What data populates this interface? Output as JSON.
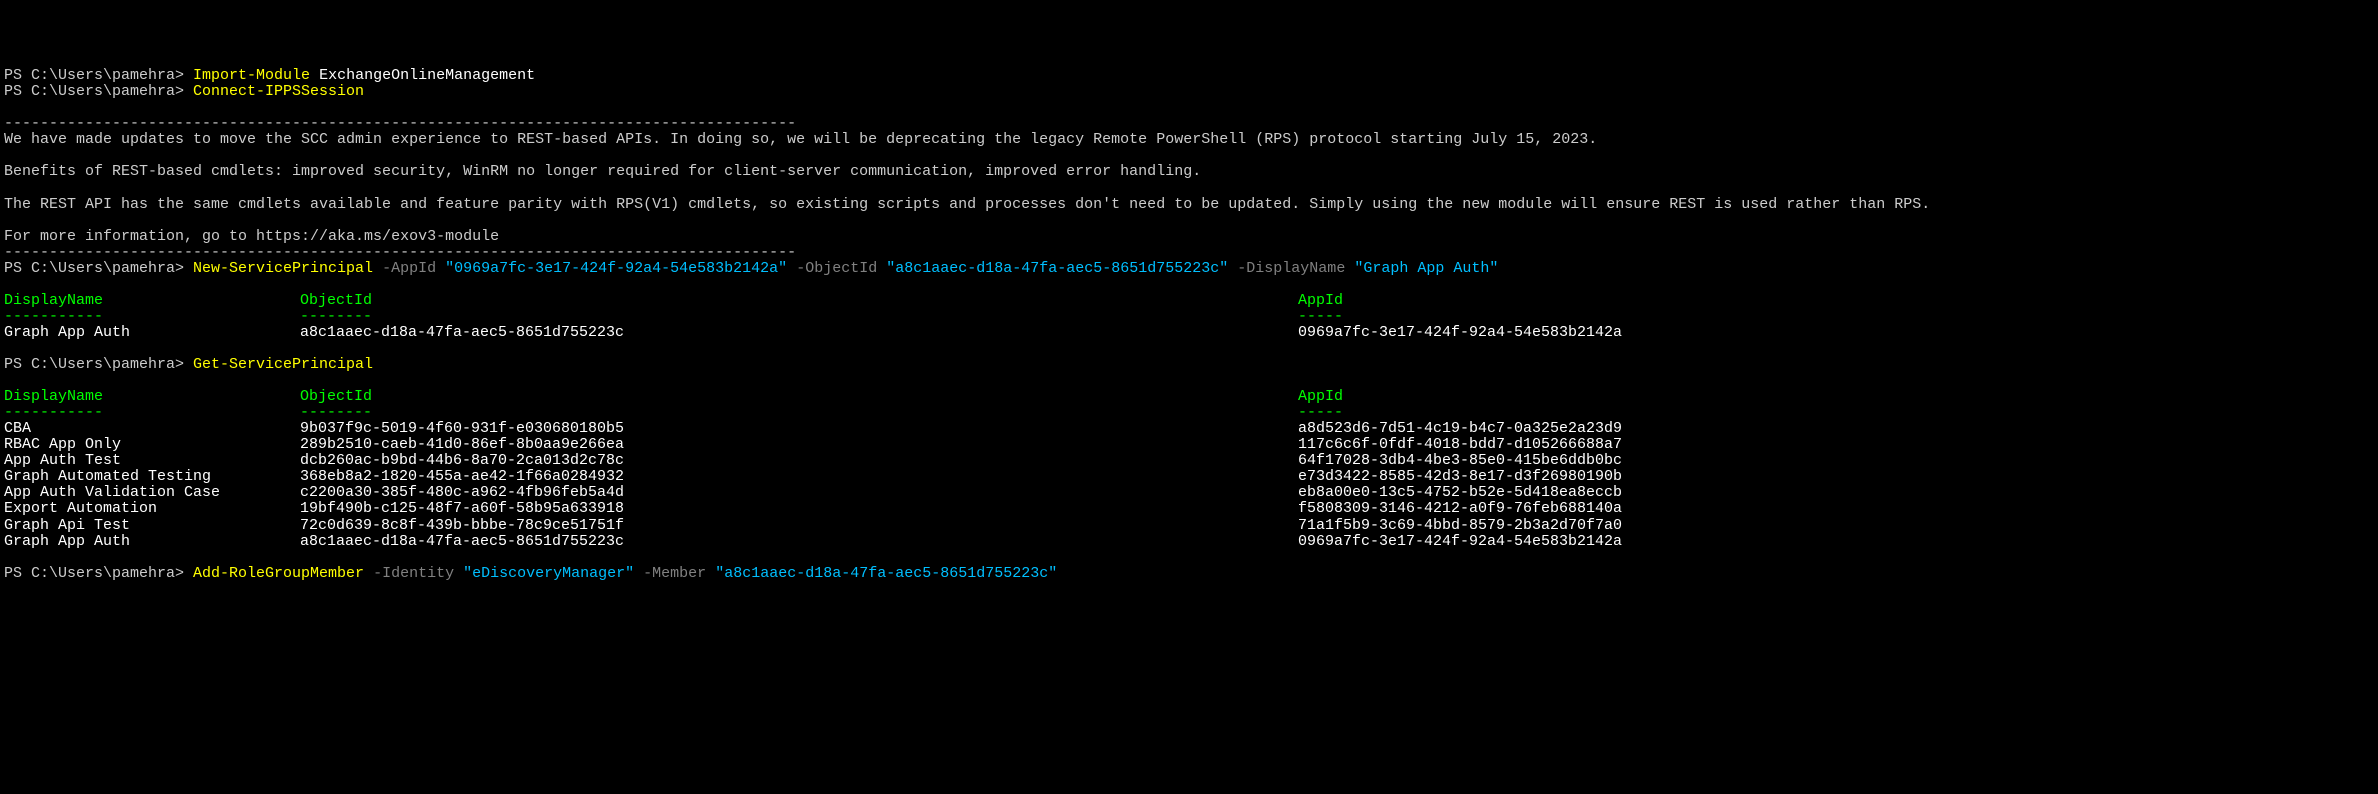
{
  "prompt_text": "PS C:\\Users\\pamehra> ",
  "line1": {
    "cmd": "Import-Module",
    "arg": "ExchangeOnlineManagement"
  },
  "line2": {
    "cmd": "Connect-IPPSSession"
  },
  "separator1": "----------------------------------------------------------------------------------------",
  "banner": {
    "l1": "We have made updates to move the SCC admin experience to REST-based APIs. In doing so, we will be deprecating the legacy Remote PowerShell (RPS) protocol starting July 15, 2023.",
    "l2": "Benefits of REST-based cmdlets: improved security, WinRM no longer required for client-server communication, improved error handling.",
    "l3": "The REST API has the same cmdlets available and feature parity with RPS(V1) cmdlets, so existing scripts and processes don't need to be updated. Simply using the new module will ensure REST is used rather than RPS.",
    "l4": "For more information, go to https://aka.ms/exov3-module"
  },
  "separator2": "----------------------------------------------------------------------------------------",
  "line3": {
    "cmd": "New-ServicePrincipal",
    "p1": "-AppId",
    "v1": "\"0969a7fc-3e17-424f-92a4-54e583b2142a\"",
    "p2": "-ObjectId",
    "v2": "\"a8c1aaec-d18a-47fa-aec5-8651d755223c\"",
    "p3": "-DisplayName",
    "v3": "\"Graph App Auth\""
  },
  "table1": {
    "headers": {
      "displayname": "DisplayName",
      "objectid": "ObjectId",
      "appid": "AppId"
    },
    "dashes": {
      "displayname": "-----------",
      "objectid": "--------",
      "appid": "-----"
    },
    "rows": [
      {
        "dn": "Graph App Auth",
        "oid": "a8c1aaec-d18a-47fa-aec5-8651d755223c",
        "aid": "0969a7fc-3e17-424f-92a4-54e583b2142a"
      }
    ]
  },
  "line4": {
    "cmd": "Get-ServicePrincipal"
  },
  "table2": {
    "headers": {
      "displayname": "DisplayName",
      "objectid": "ObjectId",
      "appid": "AppId"
    },
    "dashes": {
      "displayname": "-----------",
      "objectid": "--------",
      "appid": "-----"
    },
    "rows": [
      {
        "dn": "CBA",
        "oid": "9b037f9c-5019-4f60-931f-e030680180b5",
        "aid": "a8d523d6-7d51-4c19-b4c7-0a325e2a23d9"
      },
      {
        "dn": "RBAC App Only",
        "oid": "289b2510-caeb-41d0-86ef-8b0aa9e266ea",
        "aid": "117c6c6f-0fdf-4018-bdd7-d105266688a7"
      },
      {
        "dn": "App Auth Test",
        "oid": "dcb260ac-b9bd-44b6-8a70-2ca013d2c78c",
        "aid": "64f17028-3db4-4be3-85e0-415be6ddb0bc"
      },
      {
        "dn": "Graph Automated Testing",
        "oid": "368eb8a2-1820-455a-ae42-1f66a0284932",
        "aid": "e73d3422-8585-42d3-8e17-d3f26980190b"
      },
      {
        "dn": "App Auth Validation Case",
        "oid": "c2200a30-385f-480c-a962-4fb96feb5a4d",
        "aid": "eb8a00e0-13c5-4752-b52e-5d418ea8eccb"
      },
      {
        "dn": "Export Automation",
        "oid": "19bf490b-c125-48f7-a60f-58b95a633918",
        "aid": "f5808309-3146-4212-a0f9-76feb688140a"
      },
      {
        "dn": "Graph Api Test",
        "oid": "72c0d639-8c8f-439b-bbbe-78c9ce51751f",
        "aid": "71a1f5b9-3c69-4bbd-8579-2b3a2d70f7a0"
      },
      {
        "dn": "Graph App Auth",
        "oid": "a8c1aaec-d18a-47fa-aec5-8651d755223c",
        "aid": "0969a7fc-3e17-424f-92a4-54e583b2142a"
      }
    ]
  },
  "line5": {
    "cmd": "Add-RoleGroupMember",
    "p1": "-Identity",
    "v1": "\"eDiscoveryManager\"",
    "p2": "-Member",
    "v2": "\"a8c1aaec-d18a-47fa-aec5-8651d755223c\""
  }
}
